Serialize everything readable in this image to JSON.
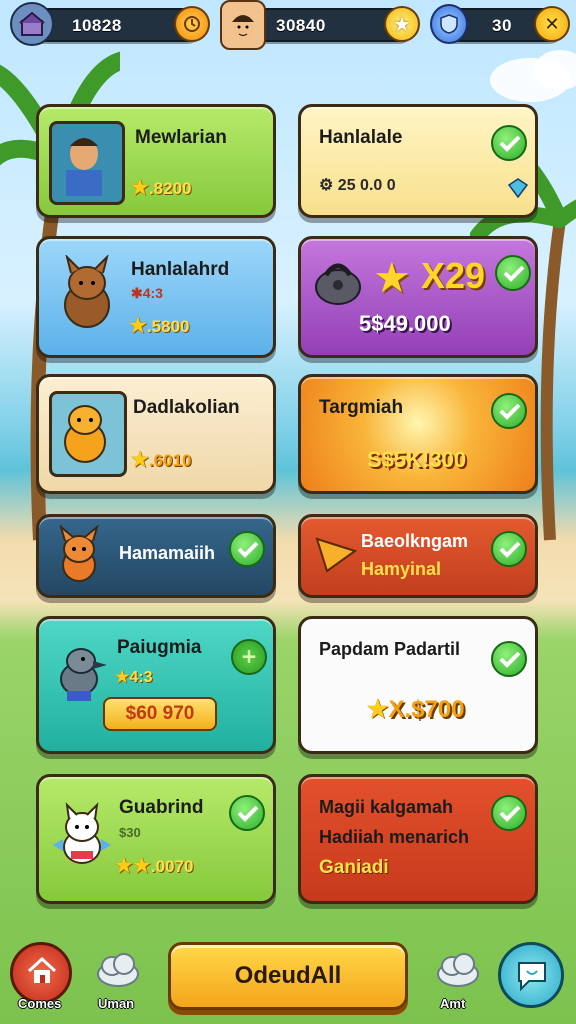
{
  "topbar": {
    "coins": "10828",
    "gems": "30840",
    "energy": "30"
  },
  "rewards": [
    {
      "title": "Mewlarian",
      "sub": ".8200",
      "status": ""
    },
    {
      "title": "Hanlalale",
      "sub": "25 0.0 0",
      "status": "done"
    },
    {
      "title": "Hanlalahrd",
      "sub2": "4:3",
      "sub": ".5800",
      "status": ""
    },
    {
      "title": "",
      "big": "X29",
      "sub": "5$49.000",
      "status": "done"
    },
    {
      "title": "Dadlakolian",
      "sub": ".6010",
      "status": ""
    },
    {
      "title": "Targmiah",
      "sub": "S$5K!300",
      "status": "done"
    },
    {
      "title": "Hamamaiih",
      "status": "done"
    },
    {
      "title": "Baeolkngam",
      "sub": "Hamyinal",
      "status": "done"
    },
    {
      "title": "Paiugmia",
      "sub2": "4:3",
      "sub": "$60 970",
      "status": "pending"
    },
    {
      "title": "Papdam Padartil",
      "sub": "X.$700",
      "status": "done"
    },
    {
      "title": "Guabrind",
      "sub2": "$30",
      "sub": ".0070",
      "status": "done"
    },
    {
      "title": "Magii kalgamah",
      "title2": "Hadiiah menarich",
      "sub": "Ganiadi",
      "status": "done"
    }
  ],
  "bottom": {
    "home_label": "Comes",
    "nav2_label": "Uman",
    "cta_label": "OdeudAll",
    "nav4_label": "Amt"
  },
  "colors": {
    "green_card": "#9bd94a",
    "yellow_card": "#fbe9a6",
    "blue_card": "#6ec1ef",
    "purple_card": "#a955c8",
    "cream_card": "#f6e5c4",
    "orange_card": "#f7a22c",
    "navy_card": "#27506f",
    "red_card": "#d9502a",
    "teal_card": "#2cc3b4",
    "white_card": "#fbfbfb"
  }
}
